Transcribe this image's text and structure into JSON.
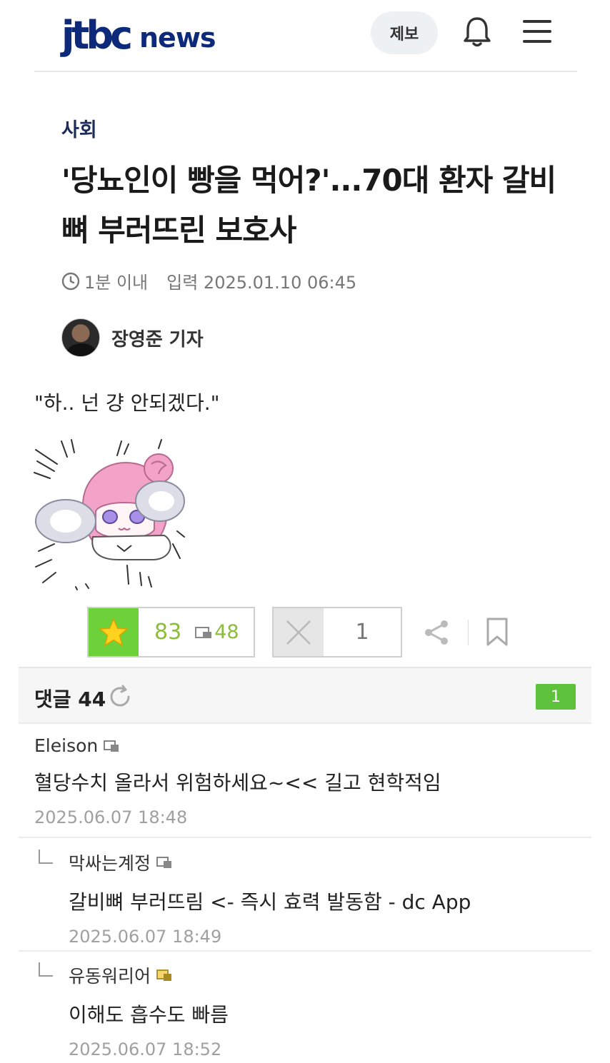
{
  "header": {
    "logo_jtbc": "jtbc",
    "logo_news": "news",
    "tip_button": "제보",
    "icons": [
      "bell-icon",
      "hamburger-menu-icon"
    ]
  },
  "article": {
    "category": "사회",
    "title": "'당뇨인이 빵을 먹어?'...70대 환자 갈비뼈 부러뜨린 보호사",
    "read_time": "1분 이내",
    "published": "입력 2025.01.10 06:45",
    "reporter": "장영준 기자",
    "quote": "\"하.. 넌 걍 안되겠다.\""
  },
  "votes": {
    "up_count": "83",
    "fixed_count": "48",
    "down_count": "1"
  },
  "comments": {
    "title": "댓글 44",
    "badge": "1",
    "items": [
      {
        "author": "Eleison",
        "text": "혈당수치 올라서 위험하세요~<< 길고 현학적임",
        "date": "2025.06.07 18:48"
      },
      {
        "author": "막싸는계정",
        "text": "갈비뼈 부러뜨림 <- 즉시 효력 발동함 - dc App",
        "date": "2025.06.07 18:49"
      },
      {
        "author": "유동워리어",
        "text": "이해도 흡수도 빠름",
        "date": "2025.06.07 18:52"
      }
    ]
  },
  "colors": {
    "brand_navy": "#0d2a7a",
    "vote_green": "#6dd13a",
    "badge_green": "#5ec23c"
  }
}
